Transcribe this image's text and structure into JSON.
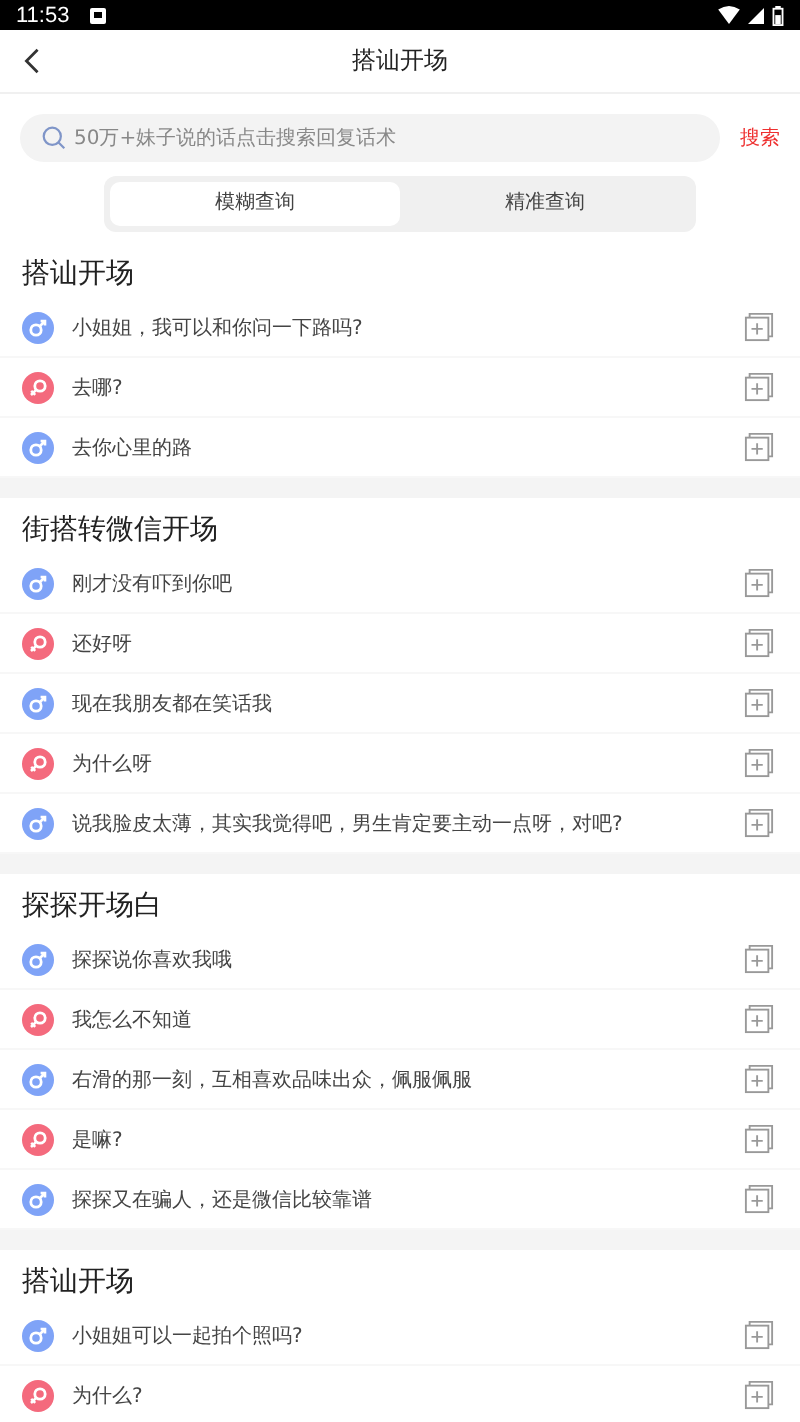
{
  "status_bar": {
    "time": "11:53"
  },
  "header": {
    "title": "搭讪开场"
  },
  "search": {
    "placeholder": "50万+妹子说的话点击搜索回复话术",
    "button": "搜索"
  },
  "tabs": [
    {
      "label": "模糊查询",
      "selected": true
    },
    {
      "label": "精准查询",
      "selected": false
    }
  ],
  "sections": [
    {
      "title": "搭讪开场",
      "rows": [
        {
          "kind": "male",
          "text": "小姐姐，我可以和你问一下路吗?"
        },
        {
          "kind": "female",
          "text": "去哪?"
        },
        {
          "kind": "male",
          "text": "去你心里的路"
        }
      ]
    },
    {
      "title": "街搭转微信开场",
      "rows": [
        {
          "kind": "male",
          "text": "刚才没有吓到你吧"
        },
        {
          "kind": "female",
          "text": "还好呀"
        },
        {
          "kind": "male",
          "text": "现在我朋友都在笑话我"
        },
        {
          "kind": "female",
          "text": "为什么呀"
        },
        {
          "kind": "male",
          "text": "说我脸皮太薄，其实我觉得吧，男生肯定要主动一点呀，对吧?"
        }
      ]
    },
    {
      "title": "探探开场白",
      "rows": [
        {
          "kind": "male",
          "text": "探探说你喜欢我哦"
        },
        {
          "kind": "female",
          "text": "我怎么不知道"
        },
        {
          "kind": "male",
          "text": "右滑的那一刻，互相喜欢品味出众，佩服佩服"
        },
        {
          "kind": "female",
          "text": "是嘛?"
        },
        {
          "kind": "male",
          "text": "探探又在骗人，还是微信比较靠谱"
        }
      ]
    },
    {
      "title": "搭讪开场",
      "rows": [
        {
          "kind": "male",
          "text": "小姐姐可以一起拍个照吗?"
        },
        {
          "kind": "female",
          "text": "为什么?"
        }
      ]
    }
  ]
}
